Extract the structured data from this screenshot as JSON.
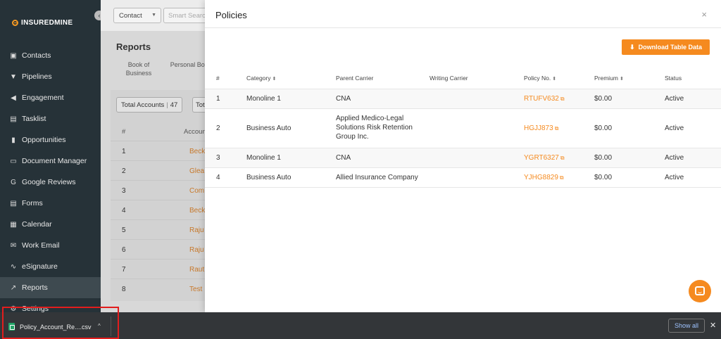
{
  "brand": {
    "name": "INSUREDMINE",
    "accent": "#f58a1f"
  },
  "sidebar": {
    "items": [
      {
        "label": "Contacts",
        "icon": "contacts-icon",
        "glyph": "▣"
      },
      {
        "label": "Pipelines",
        "icon": "pipelines-icon",
        "glyph": "▼"
      },
      {
        "label": "Engagement",
        "icon": "megaphone-icon",
        "glyph": "◀"
      },
      {
        "label": "Tasklist",
        "icon": "tasklist-icon",
        "glyph": "▤"
      },
      {
        "label": "Opportunities",
        "icon": "opportunities-icon",
        "glyph": "▮"
      },
      {
        "label": "Document Manager",
        "icon": "folder-icon",
        "glyph": "▭"
      },
      {
        "label": "Google Reviews",
        "icon": "google-icon",
        "glyph": "G"
      },
      {
        "label": "Forms",
        "icon": "forms-icon",
        "glyph": "▤"
      },
      {
        "label": "Calendar",
        "icon": "calendar-icon",
        "glyph": "▦"
      },
      {
        "label": "Work Email",
        "icon": "email-icon",
        "glyph": "✉"
      },
      {
        "label": "eSignature",
        "icon": "signature-icon",
        "glyph": "∿"
      },
      {
        "label": "Reports",
        "icon": "chart-icon",
        "glyph": "↗"
      },
      {
        "label": "Settings",
        "icon": "gear-icon",
        "glyph": "⚙"
      }
    ]
  },
  "topbar": {
    "contact_type": "Contact",
    "search_placeholder": "Smart Search"
  },
  "reports": {
    "title": "Reports",
    "tabs": [
      "Book of Business",
      "Personal Book"
    ],
    "total_label": "Total Accounts",
    "total_value": "47",
    "total2_label": "Tot",
    "table": {
      "headers": [
        "#",
        "Account"
      ],
      "rows": [
        {
          "num": "1",
          "account": "Beck"
        },
        {
          "num": "2",
          "account": "Glea"
        },
        {
          "num": "3",
          "account": "Com"
        },
        {
          "num": "4",
          "account": "Beck"
        },
        {
          "num": "5",
          "account": "Raju"
        },
        {
          "num": "6",
          "account": "Raju"
        },
        {
          "num": "7",
          "account": "Raut"
        },
        {
          "num": "8",
          "account": "Test"
        }
      ]
    }
  },
  "modal": {
    "title": "Policies",
    "close": "×",
    "download_label": "Download Table Data",
    "headers": {
      "num": "#",
      "category": "Category",
      "parent_carrier": "Parent Carrier",
      "writing_carrier": "Writing Carrier",
      "policy_no": "Policy No.",
      "premium": "Premium",
      "status": "Status"
    },
    "rows": [
      {
        "num": "1",
        "category": "Monoline 1",
        "parent_carrier": "CNA",
        "writing_carrier": "",
        "policy_no": "RTUFV632",
        "premium": "$0.00",
        "status": "Active"
      },
      {
        "num": "2",
        "category": "Business Auto",
        "parent_carrier": "Applied Medico-Legal Solutions Risk Retention Group Inc.",
        "writing_carrier": "",
        "policy_no": "HGJJ873",
        "premium": "$0.00",
        "status": "Active"
      },
      {
        "num": "3",
        "category": "Monoline 1",
        "parent_carrier": "CNA",
        "writing_carrier": "",
        "policy_no": "YGRT6327",
        "premium": "$0.00",
        "status": "Active"
      },
      {
        "num": "4",
        "category": "Business Auto",
        "parent_carrier": "Allied Insurance Company",
        "writing_carrier": "",
        "policy_no": "YJHG8829",
        "premium": "$0.00",
        "status": "Active"
      }
    ]
  },
  "downloads": {
    "filename": "Policy_Account_Re....csv",
    "show_all": "Show all",
    "close": "✕"
  }
}
